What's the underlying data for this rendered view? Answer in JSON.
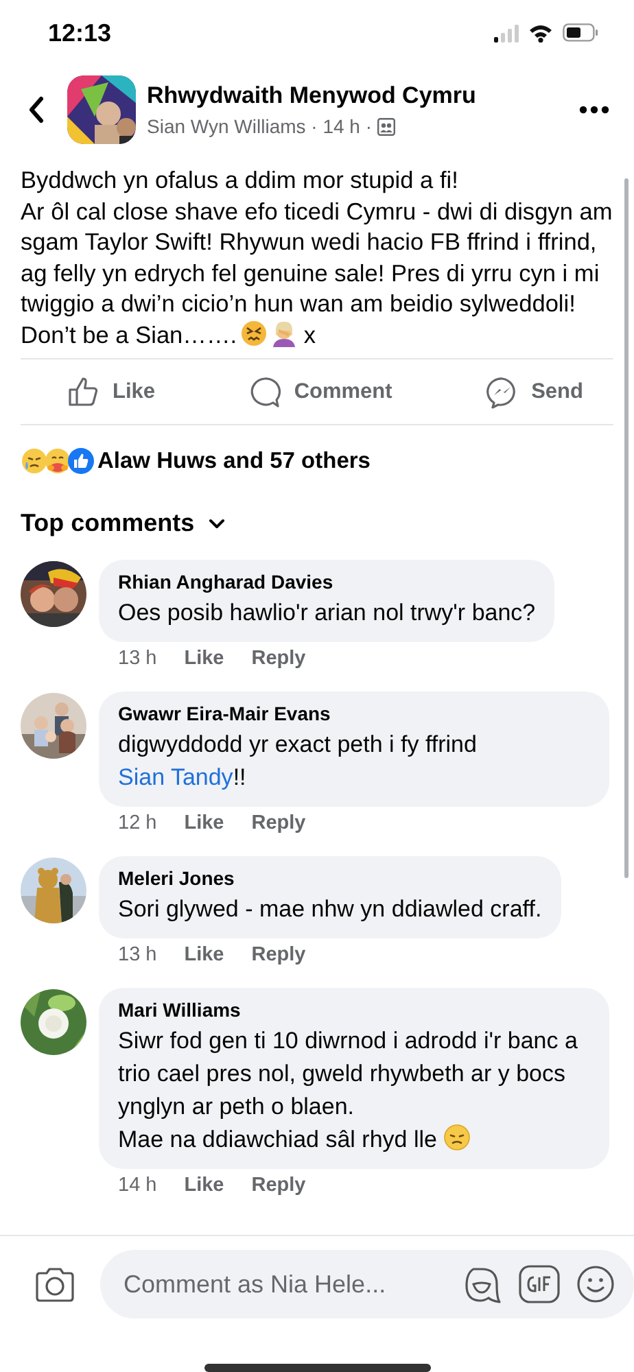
{
  "status_bar": {
    "time": "12:13"
  },
  "header": {
    "group": "Rhwydwaith Menywod Cymru",
    "meta": "Sian Wyn Williams · 14 h ·"
  },
  "post": {
    "paragraphs": [
      "Byddwch yn ofalus a ddim mor stupid a fi!",
      "Ar ôl cal close shave efo ticedi Cymru - dwi di disgyn am sgam Taylor Swift! Rhywun wedi hacio FB ffrind i ffrind, ag felly yn edrych fel genuine sale! Pres di yrru cyn i mi twiggio a dwi’n cicio’n hun wan am beidio sylweddoli! Don’t be a Sian……."
    ],
    "suffix": "x"
  },
  "actions": [
    {
      "kind": "like",
      "label": "Like"
    },
    {
      "kind": "comment",
      "label": "Comment"
    },
    {
      "kind": "send",
      "label": "Send"
    }
  ],
  "reactions": {
    "summary": "Alaw Huws and 57 others"
  },
  "comments_header": {
    "label": "Top comments"
  },
  "comments": [
    {
      "author": "Rhian Angharad Davies",
      "parts": [
        {
          "kind": "text",
          "text": "Oes posib hawlio'r arian nol trwy'r banc?"
        }
      ],
      "age": "13 h",
      "like": "Like",
      "reply": "Reply"
    },
    {
      "author": "Gwawr Eira-Mair Evans",
      "parts": [
        {
          "kind": "text",
          "text": "digwyddodd yr exact peth i fy ffrind "
        },
        {
          "kind": "link",
          "text": "Sian Tandy"
        },
        {
          "kind": "text",
          "text": "!!"
        }
      ],
      "age": "12 h",
      "like": "Like",
      "reply": "Reply"
    },
    {
      "author": "Meleri Jones",
      "parts": [
        {
          "kind": "text",
          "text": "Sori glywed - mae nhw yn ddiawled craff."
        }
      ],
      "age": "13 h",
      "like": "Like",
      "reply": "Reply"
    },
    {
      "author": "Mari Williams",
      "parts": [
        {
          "kind": "text",
          "text": "Siwr fod gen ti 10 diwrnod i adrodd i'r banc a trio cael pres nol, gweld rhywbeth ar y bocs ynglyn ar peth o blaen.\nMae na ddiawchiad sâl rhyd lle "
        },
        {
          "kind": "emoji"
        }
      ],
      "age": "14 h",
      "like": "Like",
      "reply": "Reply"
    }
  ],
  "composer": {
    "placeholder": "Comment as Nia Hele..."
  }
}
